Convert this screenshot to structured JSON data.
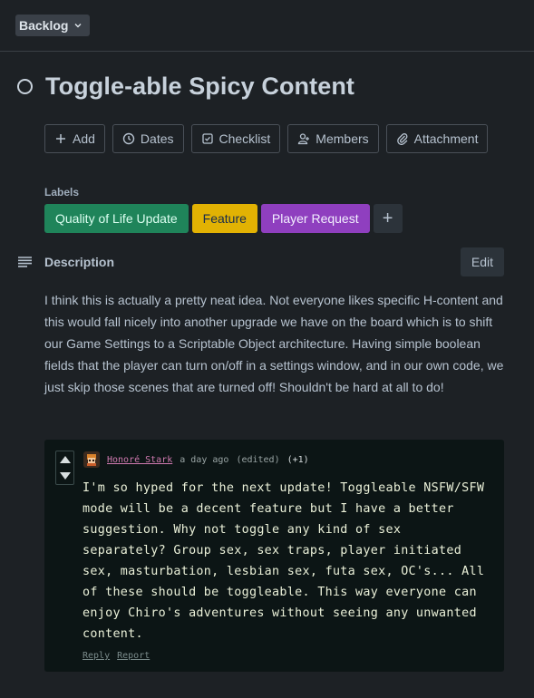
{
  "list": {
    "name": "Backlog"
  },
  "card": {
    "title": "Toggle-able Spicy Content"
  },
  "actions": [
    {
      "label": "Add",
      "icon": "plus-icon"
    },
    {
      "label": "Dates",
      "icon": "clock-icon"
    },
    {
      "label": "Checklist",
      "icon": "checkbox-icon"
    },
    {
      "label": "Members",
      "icon": "person-icon"
    },
    {
      "label": "Attachment",
      "icon": "paperclip-icon"
    }
  ],
  "labels": {
    "heading": "Labels",
    "items": [
      {
        "text": "Quality of Life Update",
        "bg": "#1f845a",
        "fg": "#dcfff1"
      },
      {
        "text": "Feature",
        "bg": "#e2b203",
        "fg": "#172b4d"
      },
      {
        "text": "Player Request",
        "bg": "#8f3fbf",
        "fg": "#f3f0ff"
      }
    ],
    "add_symbol": "+"
  },
  "description": {
    "heading": "Description",
    "edit_label": "Edit",
    "text": "I think this is actually a pretty neat idea. Not everyone likes specific H-content and this would fall nicely into another upgrade we have on the board which is to shift our Game Settings to a Scriptable Object architecture. Having simple boolean fields that the player can turn on/off in a settings window, and in our own code, we just skip those scenes that are turned off! Shouldn't be hard at all to do!"
  },
  "comment": {
    "username": "Honoré Stark",
    "time": "a day ago",
    "edited": "(edited)",
    "score": "(+1)",
    "text": "I'm so hyped for the next update! Toggleable NSFW/SFW mode will be a decent feature but I have a better suggestion. Why not toggle any kind of sex separately? Group sex, sex traps, player initiated sex, masturbation, lesbian sex, futa sex, OC's... All of these should be toggleable. This way everyone can enjoy Chiro's adventures without seeing any unwanted content.",
    "reply_label": "Reply",
    "report_label": "Report"
  }
}
